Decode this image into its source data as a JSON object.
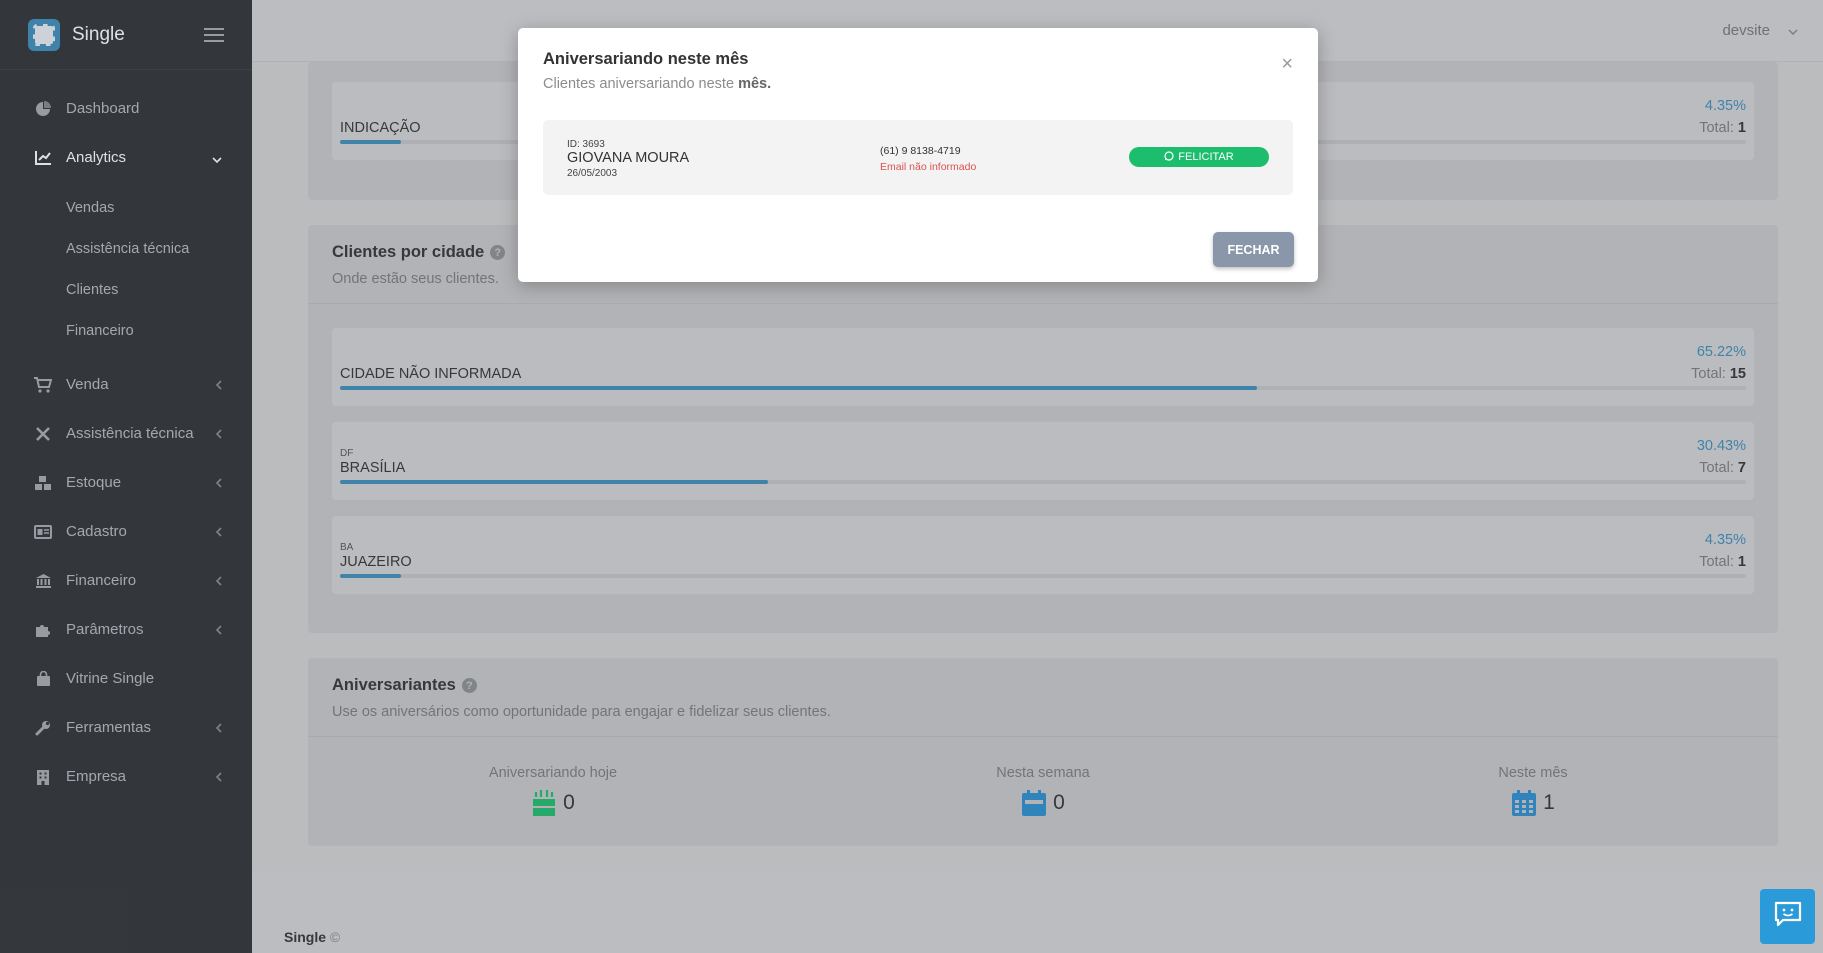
{
  "app": {
    "name": "Single"
  },
  "header": {
    "user": "devsite"
  },
  "sidebar": {
    "items": [
      {
        "label": "Dashboard"
      },
      {
        "label": "Analytics",
        "children": [
          "Vendas",
          "Assistência técnica",
          "Clientes",
          "Financeiro"
        ]
      },
      {
        "label": "Venda"
      },
      {
        "label": "Assistência técnica"
      },
      {
        "label": "Estoque"
      },
      {
        "label": "Cadastro"
      },
      {
        "label": "Financeiro"
      },
      {
        "label": "Parâmetros"
      },
      {
        "label": "Vitrine Single"
      },
      {
        "label": "Ferramentas"
      },
      {
        "label": "Empresa"
      }
    ]
  },
  "top_card": {
    "row": {
      "name": "INDICAÇÃO",
      "pct": "4.35%",
      "total_label": "Total:",
      "total": "1",
      "fraction": 0.0435
    }
  },
  "city_card": {
    "title": "Clientes por cidade",
    "subtitle": "Onde estão seus clientes.",
    "rows": [
      {
        "state": "",
        "name": "CIDADE NÃO INFORMADA",
        "pct": "65.22%",
        "total_label": "Total:",
        "total": "15",
        "fraction": 0.6522
      },
      {
        "state": "DF",
        "name": "BRASÍLIA",
        "pct": "30.43%",
        "total_label": "Total:",
        "total": "7",
        "fraction": 0.3043
      },
      {
        "state": "BA",
        "name": "JUAZEIRO",
        "pct": "4.35%",
        "total_label": "Total:",
        "total": "1",
        "fraction": 0.0435
      }
    ]
  },
  "birthday_card": {
    "title": "Aniversariantes",
    "subtitle": "Use os aniversários como oportunidade para engajar e fidelizar seus clientes.",
    "today": {
      "label": "Aniversariando hoje",
      "value": "0"
    },
    "week": {
      "label": "Nesta semana",
      "value": "0"
    },
    "month": {
      "label": "Neste mês",
      "value": "1"
    }
  },
  "footer": {
    "brand": "Single",
    "copy": "©"
  },
  "modal": {
    "title": "Aniversariando neste mês",
    "subtitle_prefix": "Clientes aniversariando neste",
    "subtitle_bold": "mês.",
    "close": "×",
    "client": {
      "id": "ID: 3693",
      "name": "GIOVANA MOURA",
      "date": "26/05/2003",
      "phone": "(61) 9 8138-4719",
      "email": "Email não informado",
      "action": "FELICITAR"
    },
    "close_button": "FECHAR"
  },
  "colors": {
    "accent": "#3c8dbc",
    "sidebar": "#2e3136",
    "whatsapp": "#1dbd6e",
    "danger": "#d9534f"
  }
}
